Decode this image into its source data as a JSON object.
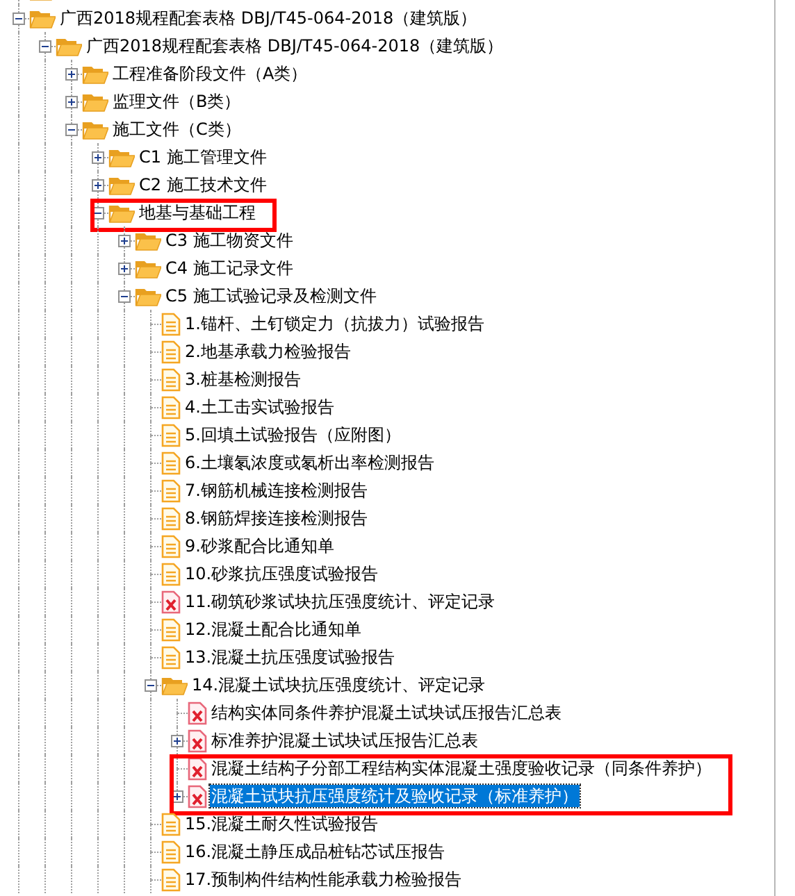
{
  "tree": [
    {
      "kind": "folder"
    },
    {
      "kind": "folder",
      "label": "广西2018规程配套表格 DBJ/T45-064-2018（建筑版）",
      "expanded": true,
      "selected": false,
      "children": [
        {
          "kind": "folder",
          "label": "广西2018规程配套表格 DBJ/T45-064-2018（建筑版）",
          "expanded": true,
          "selected": false,
          "children": [
            {
              "kind": "folder",
              "label": "工程准备阶段文件（A类）",
              "expanded": false,
              "selected": false
            },
            {
              "kind": "folder",
              "label": "监理文件（B类）",
              "expanded": false,
              "selected": false
            },
            {
              "kind": "folder",
              "label": "施工文件（C类）",
              "expanded": true,
              "selected": false,
              "children": [
                {
                  "kind": "folder",
                  "label": "C1 施工管理文件",
                  "expanded": false,
                  "selected": false
                },
                {
                  "kind": "folder",
                  "label": "C2 施工技术文件",
                  "expanded": false,
                  "selected": false
                },
                {
                  "kind": "folder",
                  "label": "地基与基础工程",
                  "expanded": true,
                  "selected": false,
                  "highlighted": true,
                  "children": [
                    {
                      "kind": "folder",
                      "label": "C3 施工物资文件",
                      "expanded": false,
                      "selected": false
                    },
                    {
                      "kind": "folder",
                      "label": "C4 施工记录文件",
                      "expanded": false,
                      "selected": false
                    },
                    {
                      "kind": "folder",
                      "label": "C5 施工试验记录及检测文件",
                      "expanded": true,
                      "selected": false,
                      "children": [
                        {
                          "kind": "document",
                          "label": "1.锚杆、土钉锁定力（抗拔力）试验报告",
                          "selected": false
                        },
                        {
                          "kind": "document",
                          "label": "2.地基承载力检验报告",
                          "selected": false
                        },
                        {
                          "kind": "document",
                          "label": "3.桩基检测报告",
                          "selected": false
                        },
                        {
                          "kind": "document",
                          "label": "4.土工击实试验报告",
                          "selected": false
                        },
                        {
                          "kind": "document",
                          "label": "5.回填土试验报告（应附图）",
                          "selected": false
                        },
                        {
                          "kind": "document",
                          "label": "6.土壤氡浓度或氡析出率检测报告",
                          "selected": false
                        },
                        {
                          "kind": "document",
                          "label": "7.钢筋机械连接检测报告",
                          "selected": false
                        },
                        {
                          "kind": "document",
                          "label": "8.钢筋焊接连接检测报告",
                          "selected": false
                        },
                        {
                          "kind": "document",
                          "label": "9.砂浆配合比通知单",
                          "selected": false
                        },
                        {
                          "kind": "document",
                          "label": "10.砂浆抗压强度试验报告",
                          "selected": false
                        },
                        {
                          "kind": "missing",
                          "label": "11.砌筑砂浆试块抗压强度统计、评定记录",
                          "selected": false
                        },
                        {
                          "kind": "document",
                          "label": "12.混凝土配合比通知单",
                          "selected": false
                        },
                        {
                          "kind": "document",
                          "label": "13.混凝土抗压强度试验报告",
                          "selected": false
                        },
                        {
                          "kind": "folder",
                          "label": "14.混凝土试块抗压强度统计、评定记录",
                          "expanded": true,
                          "selected": false,
                          "children": [
                            {
                              "kind": "missing",
                              "label": "结构实体同条件养护混凝土试块试压报告汇总表",
                              "selected": false
                            },
                            {
                              "kind": "missing",
                              "label": "标准养护混凝土试块试压报告汇总表",
                              "expanded": false,
                              "selected": false
                            },
                            {
                              "kind": "missing",
                              "label": "混凝土结构子分部工程结构实体混凝土强度验收记录（同条件养护）",
                              "selected": false,
                              "highlighted": true
                            },
                            {
                              "kind": "missing",
                              "label": "混凝土试块抗压强度统计及验收记录（标准养护）",
                              "expanded": false,
                              "selected": true,
                              "highlighted": true
                            }
                          ]
                        },
                        {
                          "kind": "document",
                          "label": "15.混凝土耐久性试验报告",
                          "selected": false
                        },
                        {
                          "kind": "document",
                          "label": "16.混凝土静压成品桩钻芯试压报告",
                          "selected": false
                        },
                        {
                          "kind": "document",
                          "label": "17.预制构件结构性能承载力检验报告",
                          "selected": false
                        }
                      ]
                    }
                  ]
                }
              ]
            }
          ]
        }
      ]
    }
  ]
}
